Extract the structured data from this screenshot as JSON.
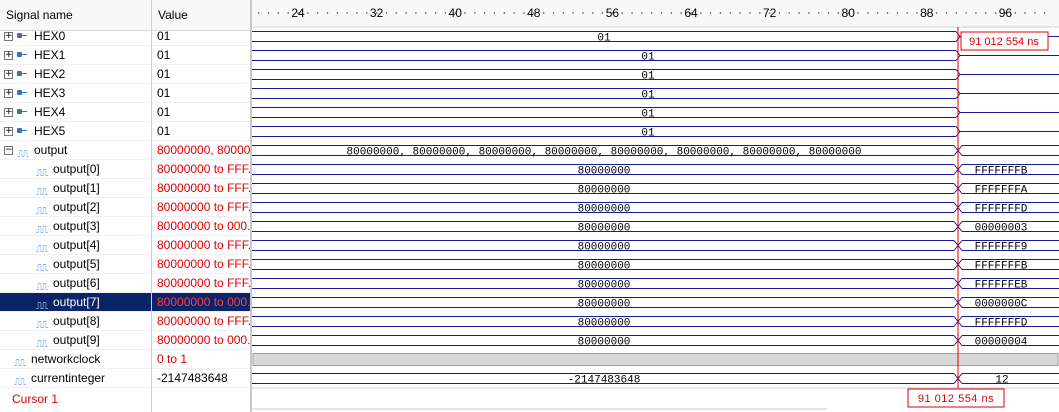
{
  "header": {
    "signal_name": "Signal name",
    "value": "Value"
  },
  "ruler": {
    "ticks": [
      "24",
      "32",
      "40",
      "48",
      "56",
      "64",
      "72",
      "80",
      "88",
      "96"
    ]
  },
  "cursor": {
    "label": "Cursor 1",
    "time": "91 012 554 ns",
    "time_top": "91 012 554 ns"
  },
  "colors": {
    "wave": "#1a1a99",
    "cursor": "#e00000",
    "selected": "#0a246a"
  },
  "signals": [
    {
      "name": "HEX0",
      "type": "bus",
      "expandable": true,
      "value": "01",
      "value_red": false,
      "wave_before": "01",
      "wave_after": ""
    },
    {
      "name": "HEX1",
      "type": "bus",
      "expandable": true,
      "value": "01",
      "value_red": false,
      "wave_before": "01",
      "wave_after": ""
    },
    {
      "name": "HEX2",
      "type": "bus",
      "expandable": true,
      "value": "01",
      "value_red": false,
      "wave_before": "01",
      "wave_after": ""
    },
    {
      "name": "HEX3",
      "type": "bus",
      "expandable": true,
      "value": "01",
      "value_red": false,
      "wave_before": "01",
      "wave_after": ""
    },
    {
      "name": "HEX4",
      "type": "bus",
      "expandable": true,
      "value": "01",
      "value_red": false,
      "wave_before": "01",
      "wave_after": ""
    },
    {
      "name": "HEX5",
      "type": "bus",
      "expandable": true,
      "value": "01",
      "value_red": false,
      "wave_before": "01",
      "wave_after": ""
    },
    {
      "name": "output",
      "type": "clk",
      "expandable": true,
      "expanded": true,
      "value": "80000000, 80000...",
      "value_red": true,
      "wave_before": "80000000, 80000000, 80000000, 80000000, 80000000, 80000000, 80000000, 80000000",
      "wave_after": ""
    },
    {
      "name": "output[0]",
      "type": "clk",
      "child": true,
      "value": "80000000 to FFF...",
      "value_red": true,
      "wave_before": "80000000",
      "wave_after": "FFFFFFFB"
    },
    {
      "name": "output[1]",
      "type": "clk",
      "child": true,
      "value": "80000000 to FFF...",
      "value_red": true,
      "wave_before": "80000000",
      "wave_after": "FFFFFFFA"
    },
    {
      "name": "output[2]",
      "type": "clk",
      "child": true,
      "value": "80000000 to FFF...",
      "value_red": true,
      "wave_before": "80000000",
      "wave_after": "FFFFFFFD"
    },
    {
      "name": "output[3]",
      "type": "clk",
      "child": true,
      "value": "80000000 to 000...",
      "value_red": true,
      "wave_before": "80000000",
      "wave_after": "00000003"
    },
    {
      "name": "output[4]",
      "type": "clk",
      "child": true,
      "value": "80000000 to FFF...",
      "value_red": true,
      "wave_before": "80000000",
      "wave_after": "FFFFFFF9"
    },
    {
      "name": "output[5]",
      "type": "clk",
      "child": true,
      "value": "80000000 to FFF...",
      "value_red": true,
      "wave_before": "80000000",
      "wave_after": "FFFFFFFB"
    },
    {
      "name": "output[6]",
      "type": "clk",
      "child": true,
      "value": "80000000 to FFF...",
      "value_red": true,
      "wave_before": "80000000",
      "wave_after": "FFFFFFEB"
    },
    {
      "name": "output[7]",
      "type": "clk",
      "child": true,
      "selected": true,
      "value": "80000000 to 000...",
      "value_red": true,
      "wave_before": "80000000",
      "wave_after": "0000000C"
    },
    {
      "name": "output[8]",
      "type": "clk",
      "child": true,
      "value": "80000000 to FFF...",
      "value_red": true,
      "wave_before": "80000000",
      "wave_after": "FFFFFFFD"
    },
    {
      "name": "output[9]",
      "type": "clk",
      "child": true,
      "value": "80000000 to 000...",
      "value_red": true,
      "wave_before": "80000000",
      "wave_after": "00000004"
    },
    {
      "name": "networkclock",
      "type": "clk",
      "value": "0 to 1",
      "value_red": true,
      "wave_before": "",
      "wave_after": ""
    },
    {
      "name": "currentinteger",
      "type": "clk",
      "value": "-2147483648",
      "value_red": false,
      "wave_before": "-2147483648",
      "wave_after": "12"
    }
  ]
}
